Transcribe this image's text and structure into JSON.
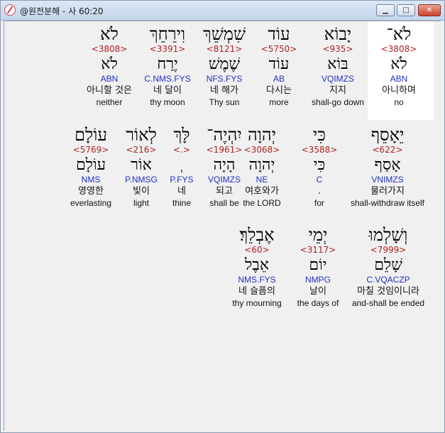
{
  "window": {
    "title": "@원전분해 - 사 60:20",
    "min_icon": "minimize-icon",
    "max_icon": "maximize-icon",
    "close_icon": "close-icon",
    "min_glyph": "▁",
    "max_glyph": "□",
    "close_glyph": "✕"
  },
  "rows": [
    {
      "words": [
        {
          "heb": "לֹא־",
          "strong": "<3808>",
          "lex": "לֹא",
          "morph": "ABN",
          "ko": "아니하며",
          "en": "no"
        },
        {
          "heb": "יָבוֹא",
          "strong": "<935>",
          "lex": "בּוֹא",
          "morph": "VQIMZS",
          "ko": "지지",
          "en": "shall-go down"
        },
        {
          "heb": "עוֹד",
          "strong": "<5750>",
          "lex": "עוֹד",
          "morph": "AB",
          "ko": "다시는",
          "en": "more"
        },
        {
          "heb": "שִׁמְשֵׁךְ",
          "strong": "<8121>",
          "lex": "שֶׁמֶשׁ",
          "morph": "NFS.FYS",
          "ko": "네 해가",
          "en": "Thy sun"
        },
        {
          "heb": "וִירֵחֵךְ",
          "strong": "<3391>",
          "lex": "יֶרַח",
          "morph": "C.NMS.FYS",
          "ko": "네 달이",
          "en": "thy moon"
        },
        {
          "heb": "לֹא",
          "strong": "<3808>",
          "lex": "לֹא",
          "morph": "ABN",
          "ko": "아니할 것은",
          "en": "neither"
        }
      ]
    },
    {
      "words": [
        {
          "heb": "יֵאָסֵף",
          "strong": "<622>",
          "lex": "אָסַף",
          "morph": "VNIMZS",
          "ko": "물러가지",
          "en": "shall-withdraw itself"
        },
        {
          "heb": "כִּי",
          "strong": "<3588>",
          "lex": "כִּי",
          "morph": "C",
          "ko": ".",
          "en": "for"
        },
        {
          "heb": "יְהוָה",
          "strong": "<3068>",
          "lex": "יְהוָה",
          "morph": "NE",
          "ko": "여호와가",
          "en": "the LORD"
        },
        {
          "heb": "יִהְיֶה־",
          "strong": "<1961>",
          "lex": "הָיָה",
          "morph": "VQIMZS",
          "ko": "되고",
          "en": "shall be"
        },
        {
          "heb": "לָּךְ",
          "strong": "<.>",
          "lex": "ְ",
          "morph": "P.FYS",
          "ko": "네",
          "en": "thine"
        },
        {
          "heb": "לְאוֹר",
          "strong": "<216>",
          "lex": "אוֹר",
          "morph": "P.NMSG",
          "ko": "빛이",
          "en": "light"
        },
        {
          "heb": "עוֹלָם",
          "strong": "<5769>",
          "lex": "עוֹלָם",
          "morph": "NMS",
          "ko": "영영한",
          "en": "everlasting"
        }
      ]
    },
    {
      "words": [
        {
          "heb": "וְשָׁלְמוּ",
          "strong": "<7999>",
          "lex": "שָׁלֵם",
          "morph": "C.VQACZP",
          "ko": "마칠 것임이니라",
          "en": "and-shall be ended"
        },
        {
          "heb": "יְמֵי",
          "strong": "<3117>",
          "lex": "יוֹם",
          "morph": "NMPG",
          "ko": "날이",
          "en": "the days of"
        },
        {
          "heb": "אֶבְלֵךְ׃",
          "strong": "<60>",
          "lex": "אֵבֶל",
          "morph": "NMS.FYS",
          "ko": "네 슬픔의",
          "en": "thy mourning"
        }
      ]
    }
  ]
}
